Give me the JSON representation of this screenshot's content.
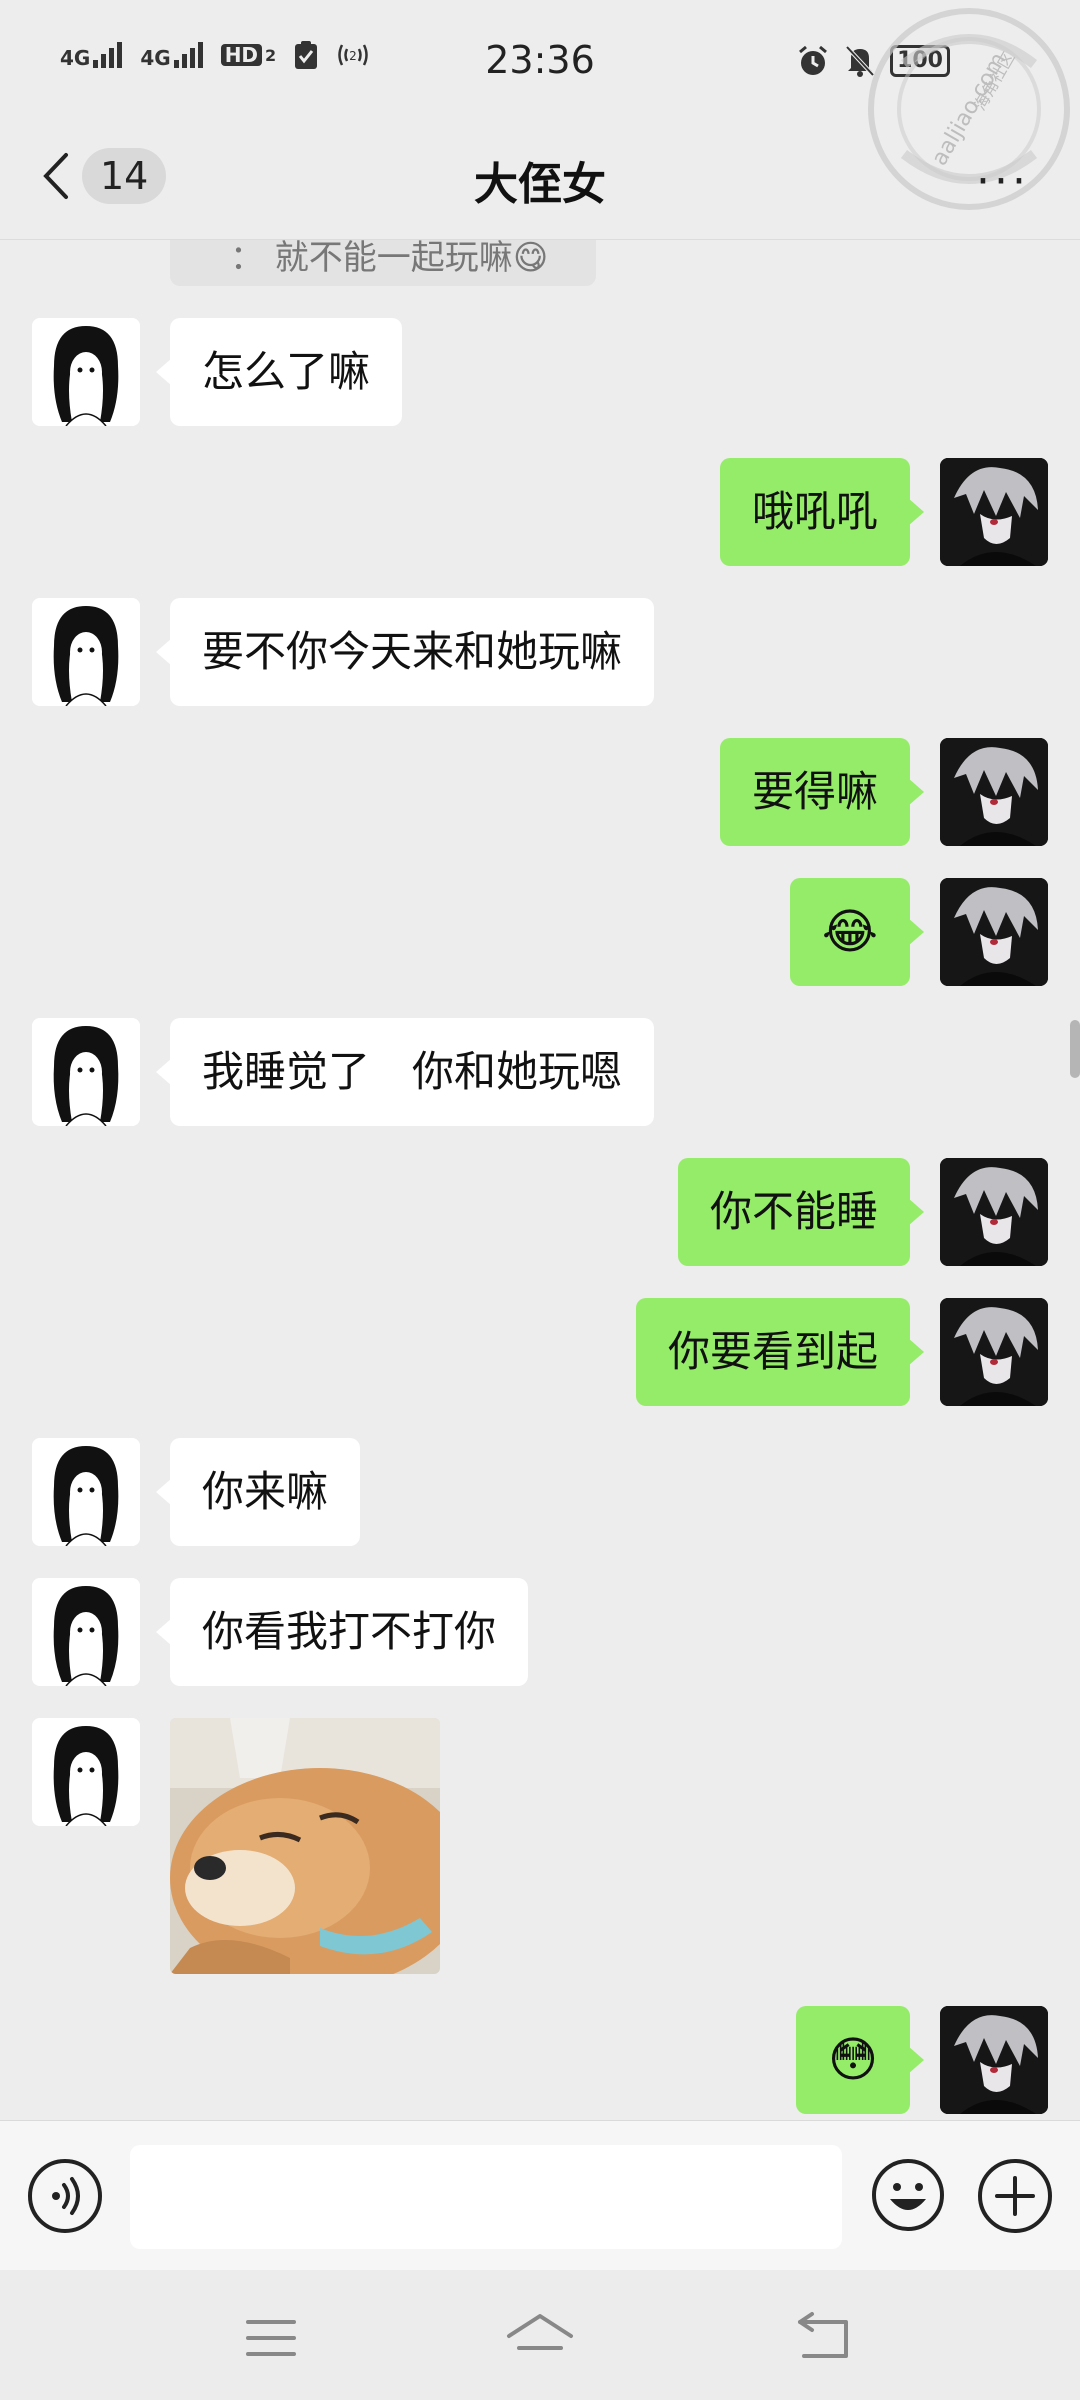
{
  "status_bar": {
    "time": "23:36",
    "signal_1_label": "4G",
    "signal_2_label": "4G",
    "hd_label": "HD",
    "hd_sub": "2",
    "battery": "100",
    "icons": [
      "alarm-icon",
      "mute-icon",
      "nfc-icon",
      "check-icon"
    ]
  },
  "watermark": {
    "text": "aaljiao.com",
    "subtext": "海角社区"
  },
  "nav": {
    "unread_count": "14",
    "title": "大侄女",
    "more_label": "···"
  },
  "chat": {
    "quote_text": "： 就不能一起玩嘛",
    "quote_emoji": "😋",
    "messages": [
      {
        "side": "in",
        "text": "怎么了嘛"
      },
      {
        "side": "out",
        "text": "哦吼吼"
      },
      {
        "side": "in",
        "text": "要不你今天来和她玩嘛"
      },
      {
        "side": "out",
        "text": "要得嘛"
      },
      {
        "side": "out",
        "text": "😂"
      },
      {
        "side": "in",
        "text": "我睡觉了　你和她玩嗯"
      },
      {
        "side": "out",
        "text": "你不能睡"
      },
      {
        "side": "out",
        "text": "你要看到起"
      },
      {
        "side": "in",
        "text": "你来嘛"
      },
      {
        "side": "in",
        "text": "你看我打不打你"
      },
      {
        "side": "in",
        "type": "sticker",
        "text": ""
      },
      {
        "side": "out",
        "text": "😳"
      }
    ]
  },
  "input_bar": {
    "voice_icon": "voice-icon",
    "emoji_icon": "emoji-icon",
    "plus_icon": "plus-icon",
    "placeholder": ""
  },
  "system_nav": {
    "icons": [
      "menu-icon",
      "home-icon",
      "back-icon"
    ]
  },
  "colors": {
    "background": "#ededed",
    "outgoing_bubble": "#95ec69",
    "incoming_bubble": "#ffffff"
  }
}
